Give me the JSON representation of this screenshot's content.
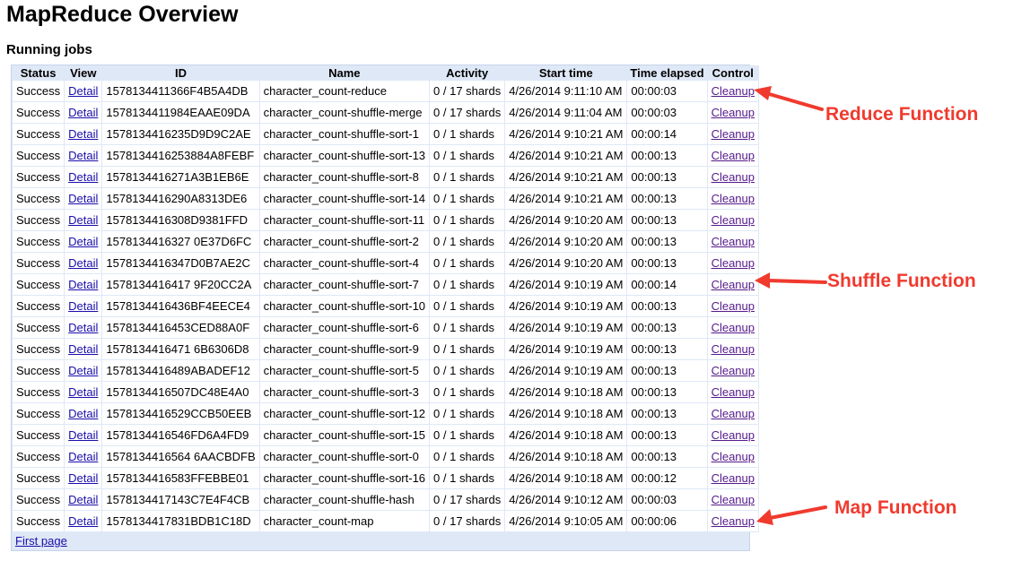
{
  "page_title": "MapReduce Overview",
  "section_title": "Running jobs",
  "table": {
    "headers": [
      "Status",
      "View",
      "ID",
      "Name",
      "Activity",
      "Start time",
      "Time elapsed",
      "Control"
    ],
    "view_label": "Detail",
    "control_label": "Cleanup",
    "rows": [
      {
        "status": "Success",
        "id": "1578134411366F4B5A4DB",
        "name": "character_count-reduce",
        "activity": "0 / 17 shards",
        "start": "4/26/2014 9:11:10 AM",
        "elapsed": "00:00:03"
      },
      {
        "status": "Success",
        "id": "1578134411984EAAE09DA",
        "name": "character_count-shuffle-merge",
        "activity": "0 / 17 shards",
        "start": "4/26/2014 9:11:04 AM",
        "elapsed": "00:00:03"
      },
      {
        "status": "Success",
        "id": "1578134416235D9D9C2AE",
        "name": "character_count-shuffle-sort-1",
        "activity": "0 / 1 shards",
        "start": "4/26/2014 9:10:21 AM",
        "elapsed": "00:00:14"
      },
      {
        "status": "Success",
        "id": "1578134416253884A8FEBF",
        "name": "character_count-shuffle-sort-13",
        "activity": "0 / 1 shards",
        "start": "4/26/2014 9:10:21 AM",
        "elapsed": "00:00:13"
      },
      {
        "status": "Success",
        "id": "1578134416271A3B1EB6E",
        "name": "character_count-shuffle-sort-8",
        "activity": "0 / 1 shards",
        "start": "4/26/2014 9:10:21 AM",
        "elapsed": "00:00:13"
      },
      {
        "status": "Success",
        "id": "1578134416290A8313DE6",
        "name": "character_count-shuffle-sort-14",
        "activity": "0 / 1 shards",
        "start": "4/26/2014 9:10:21 AM",
        "elapsed": "00:00:13"
      },
      {
        "status": "Success",
        "id": "1578134416308D9381FFD",
        "name": "character_count-shuffle-sort-11",
        "activity": "0 / 1 shards",
        "start": "4/26/2014 9:10:20 AM",
        "elapsed": "00:00:13"
      },
      {
        "status": "Success",
        "id": "1578134416327 0E37D6FC",
        "name": "character_count-shuffle-sort-2",
        "activity": "0 / 1 shards",
        "start": "4/26/2014 9:10:20 AM",
        "elapsed": "00:00:13"
      },
      {
        "status": "Success",
        "id": "1578134416347D0B7AE2C",
        "name": "character_count-shuffle-sort-4",
        "activity": "0 / 1 shards",
        "start": "4/26/2014 9:10:20 AM",
        "elapsed": "00:00:13"
      },
      {
        "status": "Success",
        "id": "1578134416417 9F20CC2A",
        "name": "character_count-shuffle-sort-7",
        "activity": "0 / 1 shards",
        "start": "4/26/2014 9:10:19 AM",
        "elapsed": "00:00:14"
      },
      {
        "status": "Success",
        "id": "1578134416436BF4EECE4",
        "name": "character_count-shuffle-sort-10",
        "activity": "0 / 1 shards",
        "start": "4/26/2014 9:10:19 AM",
        "elapsed": "00:00:13"
      },
      {
        "status": "Success",
        "id": "1578134416453CED88A0F",
        "name": "character_count-shuffle-sort-6",
        "activity": "0 / 1 shards",
        "start": "4/26/2014 9:10:19 AM",
        "elapsed": "00:00:13"
      },
      {
        "status": "Success",
        "id": "1578134416471 6B6306D8",
        "name": "character_count-shuffle-sort-9",
        "activity": "0 / 1 shards",
        "start": "4/26/2014 9:10:19 AM",
        "elapsed": "00:00:13"
      },
      {
        "status": "Success",
        "id": "1578134416489ABADEF12",
        "name": "character_count-shuffle-sort-5",
        "activity": "0 / 1 shards",
        "start": "4/26/2014 9:10:19 AM",
        "elapsed": "00:00:13"
      },
      {
        "status": "Success",
        "id": "1578134416507DC48E4A0",
        "name": "character_count-shuffle-sort-3",
        "activity": "0 / 1 shards",
        "start": "4/26/2014 9:10:18 AM",
        "elapsed": "00:00:13"
      },
      {
        "status": "Success",
        "id": "1578134416529CCB50EEB",
        "name": "character_count-shuffle-sort-12",
        "activity": "0 / 1 shards",
        "start": "4/26/2014 9:10:18 AM",
        "elapsed": "00:00:13"
      },
      {
        "status": "Success",
        "id": "1578134416546FD6A4FD9",
        "name": "character_count-shuffle-sort-15",
        "activity": "0 / 1 shards",
        "start": "4/26/2014 9:10:18 AM",
        "elapsed": "00:00:13"
      },
      {
        "status": "Success",
        "id": "1578134416564 6AACBDFB",
        "name": "character_count-shuffle-sort-0",
        "activity": "0 / 1 shards",
        "start": "4/26/2014 9:10:18 AM",
        "elapsed": "00:00:13"
      },
      {
        "status": "Success",
        "id": "1578134416583FFEBBE01",
        "name": "character_count-shuffle-sort-16",
        "activity": "0 / 1 shards",
        "start": "4/26/2014 9:10:18 AM",
        "elapsed": "00:00:12"
      },
      {
        "status": "Success",
        "id": "1578134417143C7E4F4CB",
        "name": "character_count-shuffle-hash",
        "activity": "0 / 17 shards",
        "start": "4/26/2014 9:10:12 AM",
        "elapsed": "00:00:03"
      },
      {
        "status": "Success",
        "id": "1578134417831BDB1C18D",
        "name": "character_count-map",
        "activity": "0 / 17 shards",
        "start": "4/26/2014 9:10:05 AM",
        "elapsed": "00:00:06"
      }
    ],
    "footer_link": "First page"
  },
  "annotations": {
    "reduce": "Reduce Function",
    "shuffle": "Shuffle Function",
    "map": "Map Function",
    "color": "#f03a2e"
  },
  "colors": {
    "table_bg": "#dfe8f6",
    "link": "#1a0dab",
    "visited_link": "#551a8b"
  }
}
